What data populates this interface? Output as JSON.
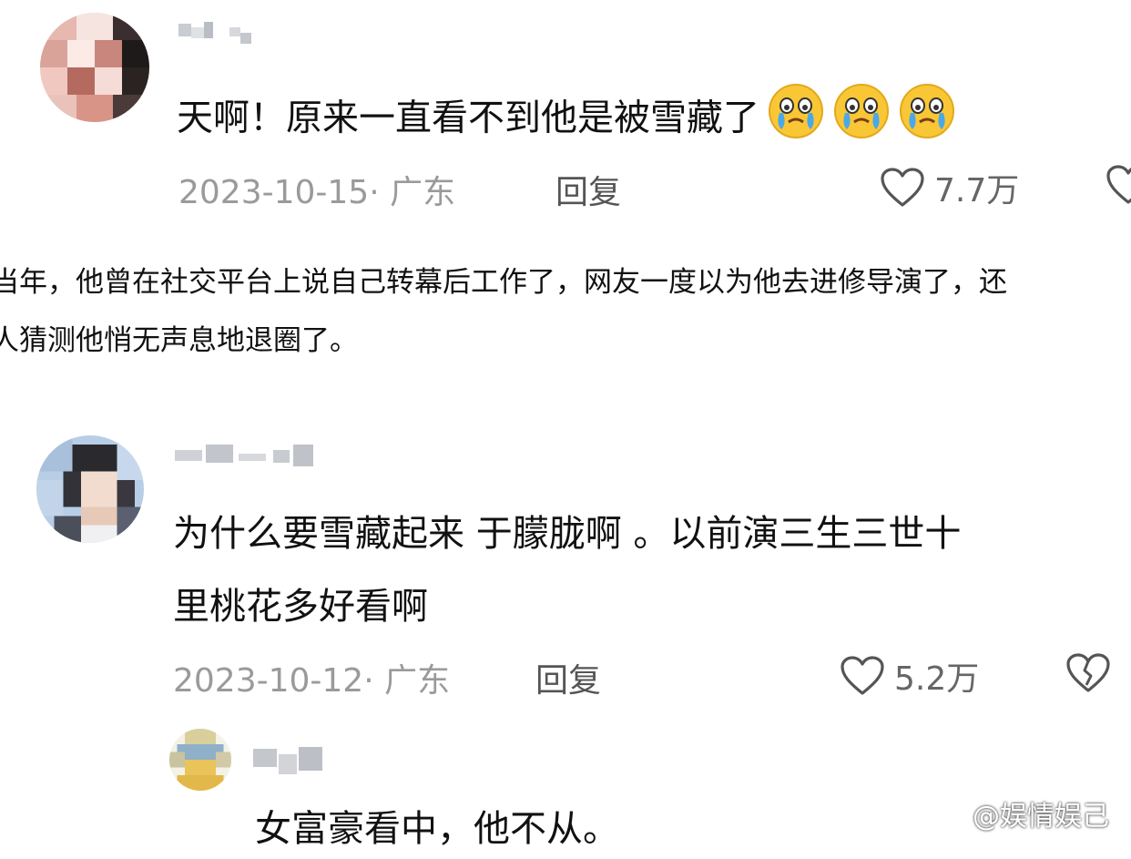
{
  "comments": [
    {
      "text": "天啊！原来一直看不到他是被雪藏了",
      "emoji": "crying-face-emoji",
      "date_location": "2023-10-15· 广东",
      "reply_label": "回复",
      "likes": "7.7万"
    },
    {
      "text_line1": "为什么要雪藏起来 于朦胧啊 。以前演三生三世十",
      "text_line2": "里桃花多好看啊",
      "date_location": "2023-10-12· 广东",
      "reply_label": "回复",
      "likes": "5.2万"
    }
  ],
  "article": {
    "line1": "当年，他曾在社交平台上说自己转幕后工作了，网友一度以为他去进修导演了，还",
    "line2": "人猜测他悄无声息地退圈了。"
  },
  "reply_comment": {
    "text": "女富豪看中，他不从。"
  },
  "watermark": {
    "text": "@娱情娱己",
    "icon": "weibo-icon"
  },
  "colors": {
    "text": "#111111",
    "meta": "#9a9a9a",
    "emoji_face": "#f9c735",
    "tear": "#4aa8e8"
  }
}
